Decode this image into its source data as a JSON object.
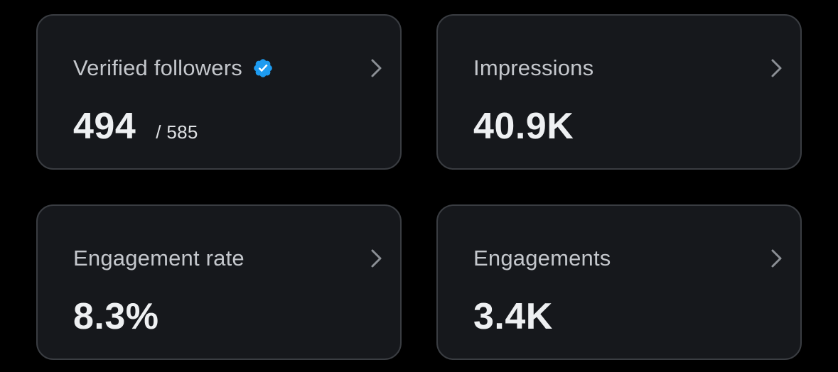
{
  "cards": [
    {
      "label": "Verified followers",
      "verified": true,
      "value": "494",
      "total": "/ 585"
    },
    {
      "label": "Impressions",
      "value": "40.9K"
    },
    {
      "label": "Engagement rate",
      "value": "8.3%"
    },
    {
      "label": "Engagements",
      "value": "3.4K"
    }
  ],
  "icons": {
    "verified": "verified-badge-icon",
    "chevron": "chevron-right-icon"
  },
  "colors": {
    "background": "#000000",
    "card_bg": "#16181c",
    "card_border": "#3a3d42",
    "label": "#c4c7cc",
    "value": "#eef0f2",
    "verified_blue": "#1d9bf0",
    "chevron": "#8b8f95"
  }
}
